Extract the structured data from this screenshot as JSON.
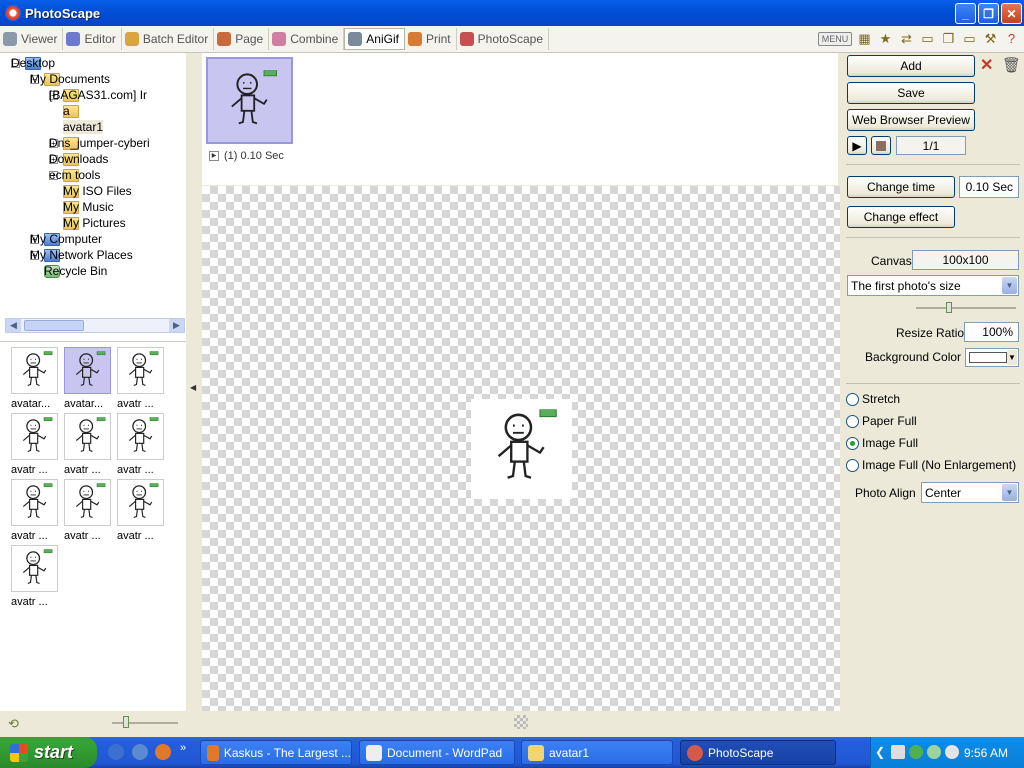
{
  "window": {
    "title": "PhotoScape"
  },
  "tabs": [
    {
      "label": "Viewer",
      "color": "#8a9aa8"
    },
    {
      "label": "Editor",
      "color": "#6c7bd0"
    },
    {
      "label": "Batch Editor",
      "color": "#d9a442"
    },
    {
      "label": "Page",
      "color": "#c86a3a"
    },
    {
      "label": "Combine",
      "color": "#d07fa0"
    },
    {
      "label": "AniGif",
      "color": "#7a8a9a"
    },
    {
      "label": "Print",
      "color": "#d97a32"
    },
    {
      "label": "PhotoScape",
      "color": "#c45050"
    }
  ],
  "active_tab": "AniGif",
  "toolbar_icons": [
    "menu-icon",
    "calendar-icon",
    "star-icon",
    "sync-icon",
    "folder-icon",
    "copy-icon",
    "blank-icon",
    "tools-icon",
    "help-icon"
  ],
  "toolbar": {
    "menu_label": "MENU"
  },
  "tree": {
    "desktop": "Desktop",
    "my_documents": "My Documents",
    "bagas": "[BAGAS31.com] Ir",
    "a": "a",
    "avatar1": "avatar1",
    "dns": "Dns_jumper-cyberi",
    "downloads": "Downloads",
    "ecm": "ecm tools",
    "iso": "My ISO Files",
    "music": "My Music",
    "pictures": "My Pictures",
    "my_computer": "My Computer",
    "network": "My Network Places",
    "recycle": "Recycle Bin"
  },
  "thumbnails": [
    "avatar...",
    "avatar...",
    "avatr ...",
    "avatr ...",
    "avatr ...",
    "avatr ...",
    "avatr ...",
    "avatr ...",
    "avatr ...",
    "avatr ..."
  ],
  "frames": {
    "info": "(1) 0.10 Sec"
  },
  "right": {
    "add": "Add",
    "save": "Save",
    "web_preview": "Web Browser Preview",
    "counter": "1/1",
    "change_time": "Change time",
    "time_value": "0.10 Sec",
    "change_effect": "Change effect",
    "canvas_label": "Canvas",
    "canvas_value": "100x100",
    "size_option": "The first photo's size",
    "resize_label": "Resize Ratio",
    "resize_value": "100%",
    "bg_label": "Background Color",
    "bg_color": "#ffffff",
    "stretch": "Stretch",
    "paper_full": "Paper Full",
    "image_full": "Image Full",
    "image_full_noenl": "Image Full (No Enlargement)",
    "align_label": "Photo Align",
    "align_value": "Center"
  },
  "taskbar": {
    "start": "start",
    "tasks": [
      {
        "label": "Kaskus - The Largest ...",
        "icon": "firefox-icon"
      },
      {
        "label": "Document - WordPad",
        "icon": "wordpad-icon"
      },
      {
        "label": "avatar1",
        "icon": "folder-icon"
      },
      {
        "label": "PhotoScape",
        "icon": "photoscape-icon"
      }
    ],
    "clock": "9:56 AM"
  }
}
